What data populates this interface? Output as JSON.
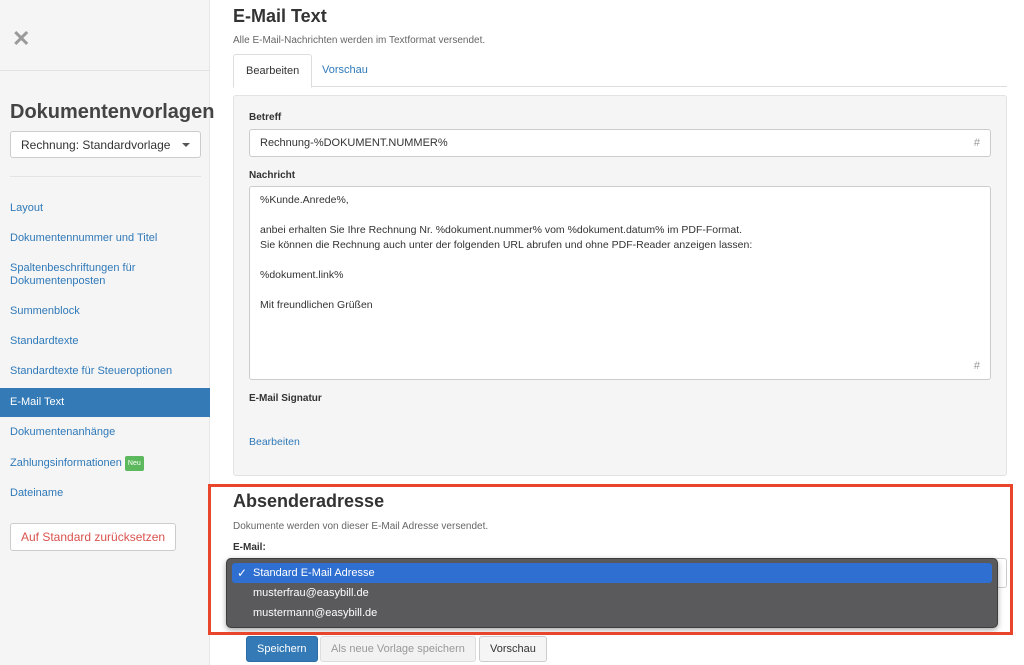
{
  "sidebar": {
    "title": "Dokumentenvorlagen",
    "template_select": "Rechnung: Standardvorlage",
    "items": [
      {
        "label": "Layout"
      },
      {
        "label": "Dokumentennummer und Titel"
      },
      {
        "label": "Spaltenbeschriftungen für Dokumentenposten"
      },
      {
        "label": "Summenblock"
      },
      {
        "label": "Standardtexte"
      },
      {
        "label": "Standardtexte für Steueroptionen"
      },
      {
        "label": "E-Mail Text"
      },
      {
        "label": "Dokumentenanhänge"
      },
      {
        "label": "Zahlungsinformationen",
        "badge": "Neu"
      },
      {
        "label": "Dateiname"
      }
    ],
    "reset_label": "Auf Standard zurücksetzen"
  },
  "header": {
    "title": "E-Mail Text",
    "subtitle": "Alle E-Mail-Nachrichten werden im Textformat versendet."
  },
  "tabs": [
    {
      "label": "Bearbeiten"
    },
    {
      "label": "Vorschau"
    }
  ],
  "form": {
    "subject_label": "Betreff",
    "subject_value": "Rechnung-%DOKUMENT.NUMMER%",
    "hash_symbol": "#",
    "message_label": "Nachricht",
    "message_lines": [
      "%Kunde.Anrede%,",
      "",
      "anbei erhalten Sie Ihre Rechnung Nr. %dokument.nummer% vom %dokument.datum% im PDF-Format.",
      "Sie können die Rechnung auch unter der folgenden URL abrufen und ohne PDF-Reader anzeigen lassen:",
      "",
      "%dokument.link%",
      "",
      "Mit freundlichen Grüßen"
    ],
    "signature_label": "E-Mail Signatur",
    "signature_edit_link": "Bearbeiten"
  },
  "sender": {
    "title": "Absenderadresse",
    "subtitle": "Dokumente werden von dieser E-Mail Adresse versendet.",
    "email_label": "E-Mail:",
    "options": [
      {
        "label": "Standard E-Mail Adresse",
        "selected": true
      },
      {
        "label": "musterfrau@easybill.de",
        "selected": false
      },
      {
        "label": "mustermann@easybill.de",
        "selected": false
      }
    ],
    "check_mark": "✓"
  },
  "actions": {
    "save": "Speichern",
    "save_as_new": "Als neue Vorlage speichern",
    "preview": "Vorschau"
  },
  "colors": {
    "accent": "#337ab7",
    "highlight_border": "#e8452b",
    "badge": "#5cb85c"
  }
}
